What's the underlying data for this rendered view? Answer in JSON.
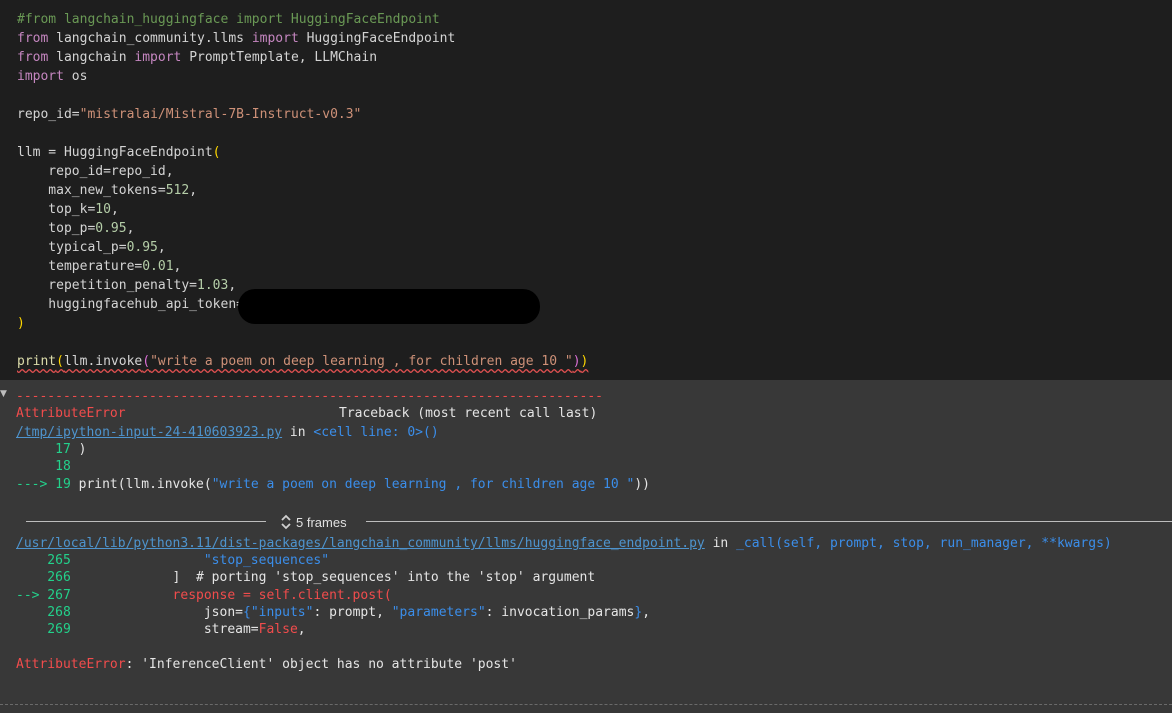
{
  "code": {
    "l1": "#from langchain_huggingface import HuggingFaceEndpoint",
    "l2": [
      "from",
      " langchain_community.llms ",
      "import",
      " HuggingFaceEndpoint"
    ],
    "l3": [
      "from",
      " langchain ",
      "import",
      " PromptTemplate, LLMChain"
    ],
    "l4": [
      "import",
      " os"
    ],
    "l6": [
      "repo_id=",
      "\"mistralai/Mistral-7B-Instruct-v0.3\""
    ],
    "l8": [
      "llm = HuggingFaceEndpoint",
      "("
    ],
    "l9": "    repo_id=repo_id,",
    "l10": [
      "    max_new_tokens=",
      "512",
      ","
    ],
    "l11": [
      "    top_k=",
      "10",
      ","
    ],
    "l12": [
      "    top_p=",
      "0.95",
      ","
    ],
    "l13": [
      "    typical_p=",
      "0.95",
      ","
    ],
    "l14": [
      "    temperature=",
      "0.01",
      ","
    ],
    "l15": [
      "    repetition_penalty=",
      "1.03",
      ","
    ],
    "l16": "    huggingfacehub_api_token=",
    "l17": ")",
    "l19": [
      "print",
      "(",
      "llm.invoke",
      "(",
      "\"write a poem on deep learning , for children age 10 \"",
      ")",
      ")"
    ]
  },
  "output": {
    "dashes": "---------------------------------------------------------------------------",
    "error_name": "AttributeError",
    "traceback_label": "Traceback (most recent call last)",
    "file1": "/tmp/ipython-input-24-410603923.py",
    "in1": " in ",
    "cell1": "<cell line: 0>()",
    "t17": [
      "     17 ",
      ")"
    ],
    "t18": "     18",
    "t19": [
      "---> 19 ",
      "print(llm.invoke(",
      "\"write a poem on deep learning , for children age 10 \"",
      "))"
    ],
    "frames_label": "5 frames",
    "file2": "/usr/local/lib/python3.11/dist-packages/langchain_community/llms/huggingface_endpoint.py",
    "in2": " in ",
    "call2": "_call(self, prompt, stop, run_manager, **kwargs)",
    "t265": [
      "    265 ",
      "                \"stop_sequences\""
    ],
    "t266": [
      "    266 ",
      "            ]  # porting 'stop_sequences' into the 'stop' argument"
    ],
    "t267": [
      "--> 267 ",
      "            response = self.client.post("
    ],
    "t268": [
      "    268 ",
      "                json=",
      "{",
      "\"inputs\"",
      ": prompt, ",
      "\"parameters\"",
      ": invocation_params",
      "}",
      ","
    ],
    "t269": [
      "    269 ",
      "                stream=",
      "False",
      ","
    ],
    "final_err": "AttributeError",
    "final_msg": ": 'InferenceClient' object has no attribute 'post'"
  }
}
